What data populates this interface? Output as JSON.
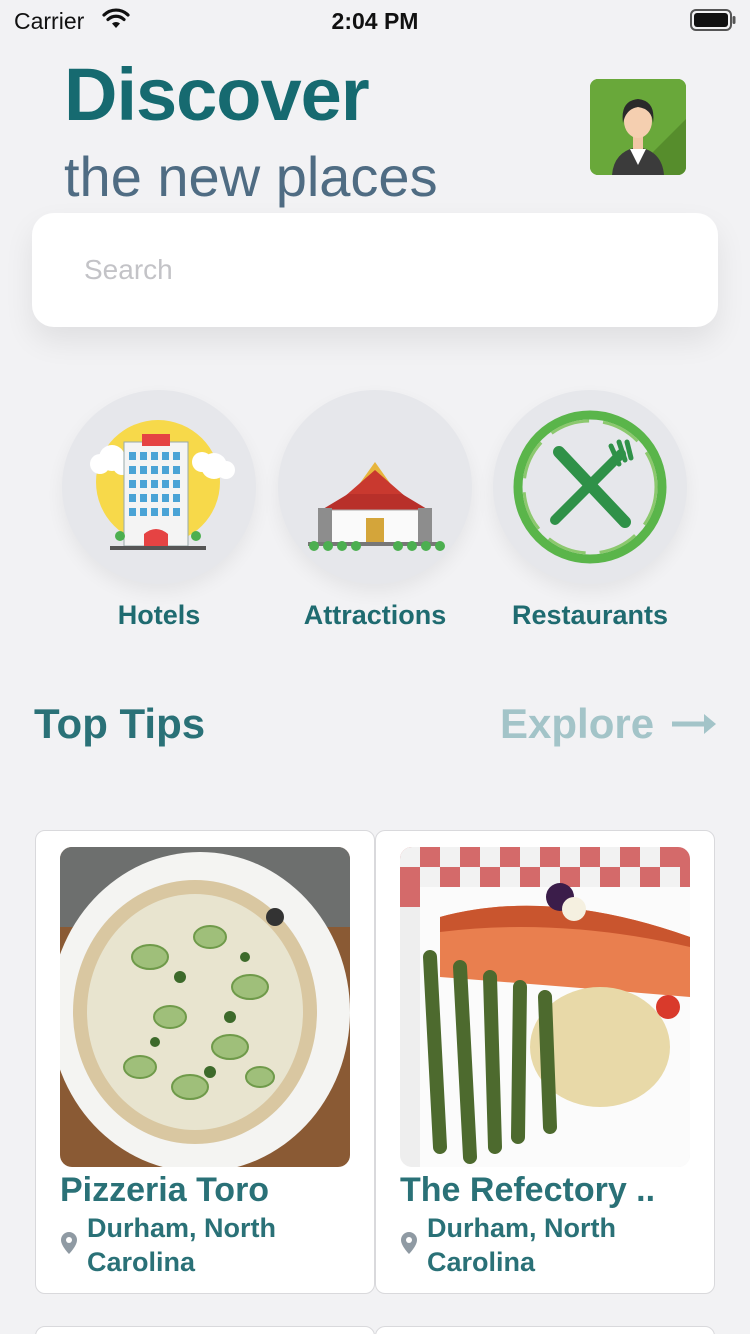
{
  "status_bar": {
    "carrier": "Carrier",
    "time": "2:04 PM"
  },
  "header": {
    "title": "Discover",
    "subtitle": "the new places"
  },
  "search": {
    "placeholder": "Search",
    "value": ""
  },
  "categories": [
    {
      "label": "Hotels",
      "icon": "hotel-icon"
    },
    {
      "label": "Attractions",
      "icon": "temple-icon"
    },
    {
      "label": "Restaurants",
      "icon": "fork-knife-icon"
    }
  ],
  "top_tips": {
    "title": "Top Tips",
    "explore_label": "Explore",
    "cards": [
      {
        "title": "Pizzeria Toro",
        "location": "Durham, North Carolina",
        "image": "pizza-photo"
      },
      {
        "title": "The Refectory ..",
        "location": "Durham, North Carolina",
        "image": "salmon-asparagus-photo"
      }
    ]
  },
  "colors": {
    "primary": "#166a70",
    "subtitle": "#4f6c83",
    "explore": "#a3c4c8",
    "background": "#f2f2f4"
  }
}
